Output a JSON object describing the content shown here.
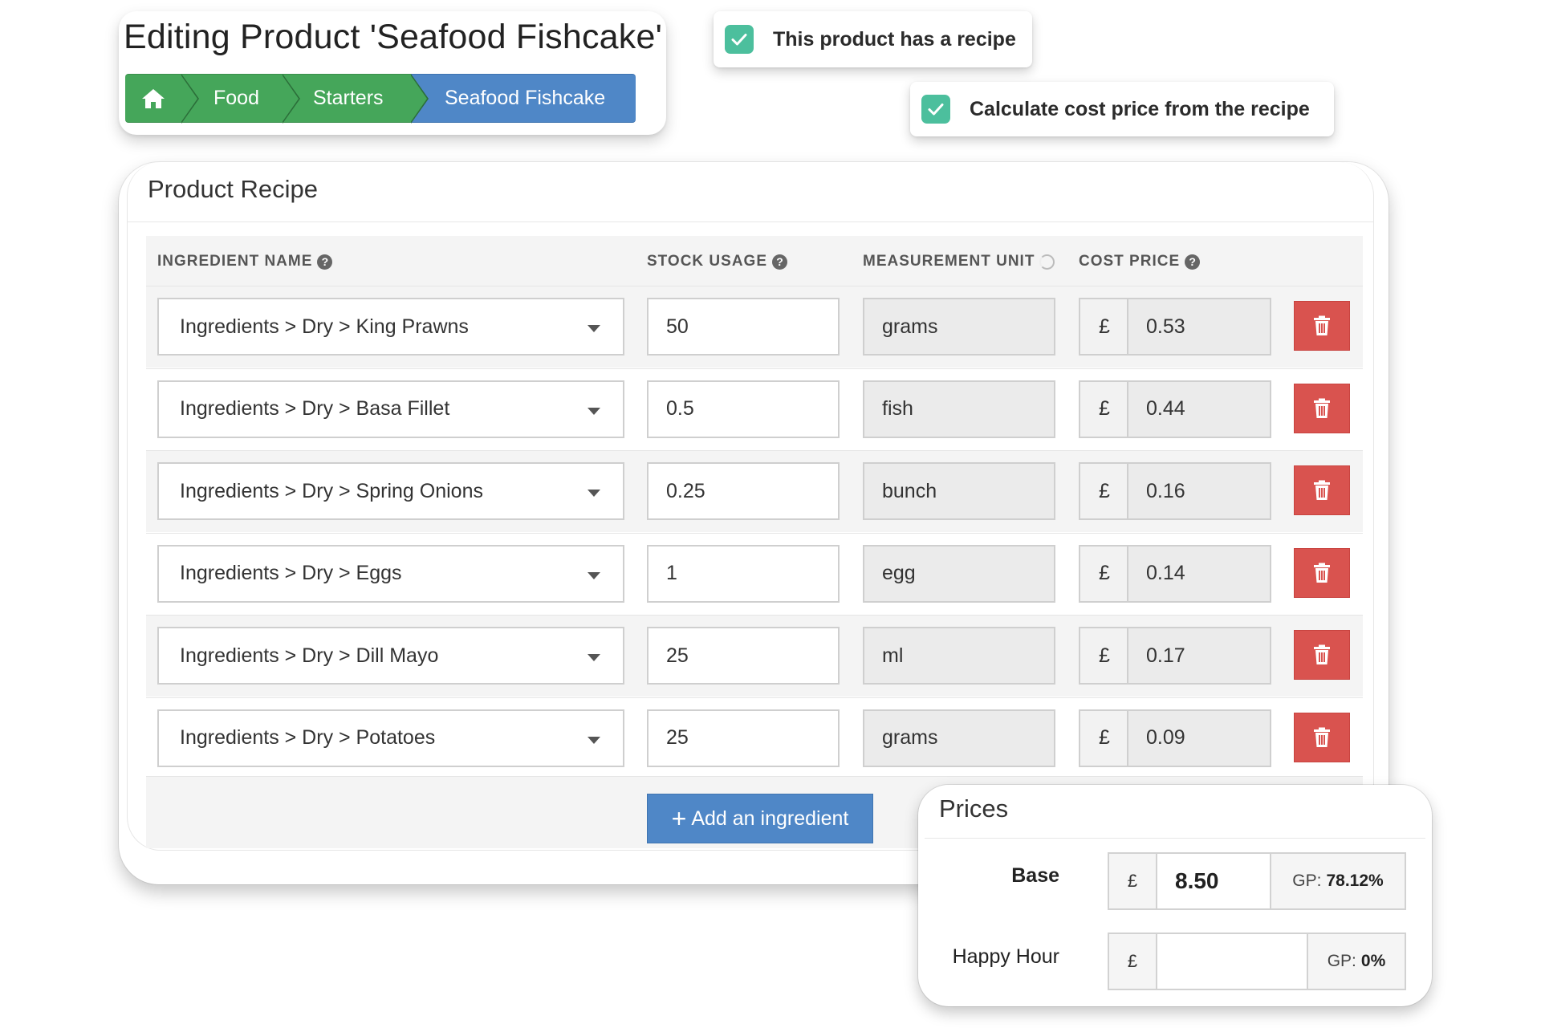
{
  "header": {
    "title": "Editing Product 'Seafood Fishcake'",
    "breadcrumb": [
      "Food",
      "Starters",
      "Seafood Fishcake"
    ]
  },
  "options": {
    "has_recipe_label": "This product has a recipe",
    "calc_cost_label": "Calculate cost price from the recipe"
  },
  "recipe": {
    "title": "Product Recipe",
    "columns": {
      "ingredient": "INGREDIENT NAME",
      "usage": "STOCK USAGE",
      "unit": "MEASUREMENT UNIT",
      "cost": "COST PRICE"
    },
    "currency": "£",
    "rows": [
      {
        "ingredient": "Ingredients > Dry > King Prawns",
        "usage": "50",
        "unit": "grams",
        "cost": "0.53"
      },
      {
        "ingredient": "Ingredients > Dry > Basa Fillet",
        "usage": "0.5",
        "unit": "fish",
        "cost": "0.44"
      },
      {
        "ingredient": "Ingredients > Dry > Spring Onions",
        "usage": "0.25",
        "unit": "bunch",
        "cost": "0.16"
      },
      {
        "ingredient": "Ingredients > Dry > Eggs",
        "usage": "1",
        "unit": "egg",
        "cost": "0.14"
      },
      {
        "ingredient": "Ingredients > Dry > Dill Mayo",
        "usage": "25",
        "unit": "ml",
        "cost": "0.17"
      },
      {
        "ingredient": "Ingredients > Dry > Potatoes",
        "usage": "25",
        "unit": "grams",
        "cost": "0.09"
      }
    ],
    "add_label": "Add an ingredient"
  },
  "prices": {
    "title": "Prices",
    "gp_label": "GP:",
    "base": {
      "label": "Base",
      "currency": "£",
      "value": "8.50",
      "gp": "78.12%"
    },
    "happy_hour": {
      "label": "Happy Hour",
      "currency": "£",
      "value": "",
      "gp": "0%"
    }
  },
  "colors": {
    "green": "#45a65a",
    "blue": "#4f87c7",
    "red": "#d9534f",
    "checkbox": "#4cbf9d"
  }
}
